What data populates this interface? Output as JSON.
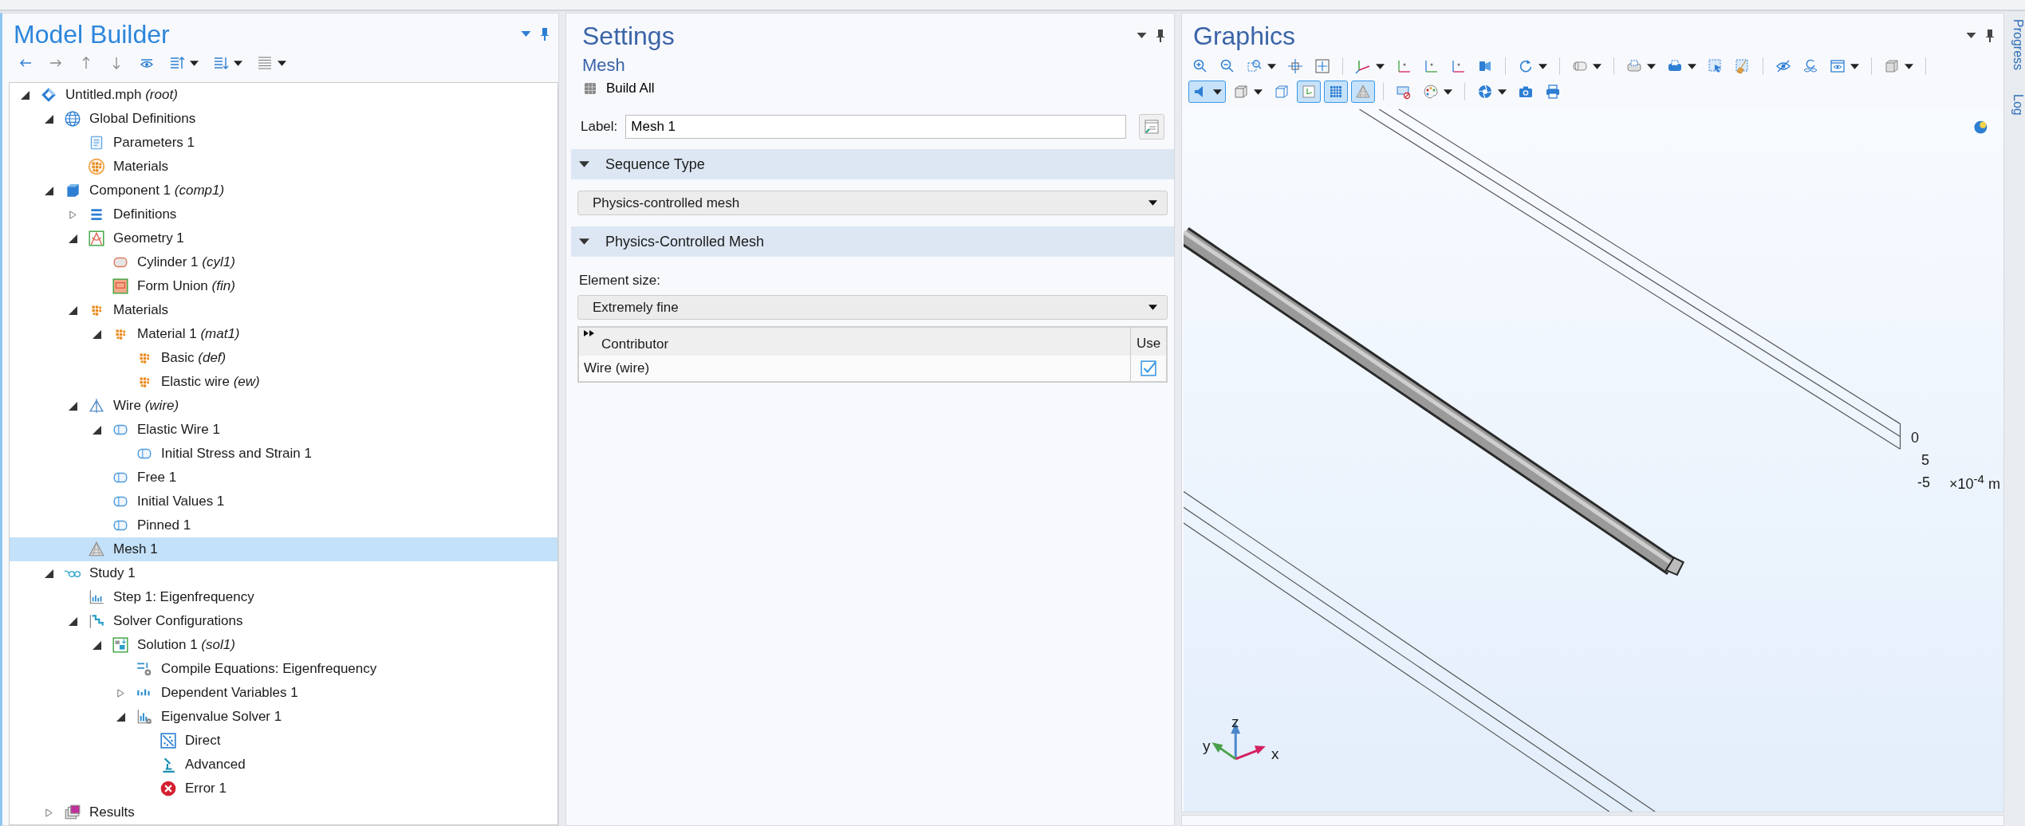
{
  "model_builder": {
    "title": "Model Builder",
    "toolbar": [
      {
        "kind": "back",
        "dropdown": false
      },
      {
        "kind": "forward",
        "dropdown": false
      },
      {
        "kind": "up",
        "dropdown": false
      },
      {
        "kind": "down",
        "dropdown": false
      },
      {
        "kind": "show",
        "dropdown": false
      },
      {
        "kind": "list-up",
        "dropdown": true
      },
      {
        "kind": "list-down",
        "dropdown": true
      },
      {
        "kind": "list",
        "dropdown": true
      }
    ],
    "tree": [
      {
        "label": "Untitled.mph  *(root)*",
        "kind": "root",
        "expanded": true,
        "selected": false,
        "children": [
          {
            "label": "Global Definitions",
            "kind": "globe",
            "expanded": true,
            "selected": false,
            "children": [
              {
                "label": "Parameters 1",
                "kind": "parameters",
                "selected": false
              },
              {
                "label": "Materials",
                "kind": "materials",
                "selected": false
              }
            ]
          },
          {
            "label": "Component 1  *(comp1)*",
            "kind": "component",
            "expanded": true,
            "selected": false,
            "children": [
              {
                "label": "Definitions",
                "kind": "definitions",
                "expanded": false,
                "selected": false
              },
              {
                "label": "Geometry 1",
                "kind": "geometry",
                "expanded": true,
                "selected": false,
                "children": [
                  {
                    "label": "Cylinder 1  *(cyl1)*",
                    "kind": "cylinder",
                    "selected": false
                  },
                  {
                    "label": "Form Union  *(fin)*",
                    "kind": "union",
                    "selected": false
                  }
                ]
              },
              {
                "label": "Materials",
                "kind": "material",
                "expanded": true,
                "selected": false,
                "children": [
                  {
                    "label": "Material 1  *(mat1)*",
                    "kind": "material",
                    "expanded": true,
                    "selected": false,
                    "children": [
                      {
                        "label": "Basic  *(def)*",
                        "kind": "material",
                        "selected": false
                      },
                      {
                        "label": "Elastic wire  *(ew)*",
                        "kind": "material",
                        "selected": false
                      }
                    ]
                  }
                ]
              },
              {
                "label": "Wire  *(wire)*",
                "kind": "physics",
                "expanded": true,
                "selected": false,
                "children": [
                  {
                    "label": "Elastic Wire 1",
                    "kind": "feature",
                    "expanded": true,
                    "selected": false,
                    "children": [
                      {
                        "label": "Initial Stress and Strain 1",
                        "kind": "feature",
                        "selected": false
                      }
                    ]
                  },
                  {
                    "label": "Free 1",
                    "kind": "feature",
                    "selected": false
                  },
                  {
                    "label": "Initial Values 1",
                    "kind": "feature",
                    "selected": false
                  },
                  {
                    "label": "Pinned 1",
                    "kind": "feature",
                    "selected": false
                  }
                ]
              },
              {
                "label": "Mesh 1",
                "kind": "mesh",
                "selected": true
              }
            ]
          },
          {
            "label": "Study 1",
            "kind": "study",
            "expanded": true,
            "selected": false,
            "children": [
              {
                "label": "Step 1: Eigenfrequency",
                "kind": "step",
                "selected": false
              },
              {
                "label": "Solver Configurations",
                "kind": "solver-config",
                "expanded": true,
                "selected": false,
                "children": [
                  {
                    "label": "Solution 1  *(sol1)*",
                    "kind": "solution",
                    "expanded": true,
                    "selected": false,
                    "children": [
                      {
                        "label": "Compile Equations: Eigenfrequency",
                        "kind": "compile",
                        "selected": false
                      },
                      {
                        "label": "Dependent Variables 1",
                        "kind": "variables",
                        "expanded": false,
                        "selected": false
                      },
                      {
                        "label": "Eigenvalue Solver 1",
                        "kind": "eigen-solver",
                        "expanded": true,
                        "selected": false,
                        "children": [
                          {
                            "label": "Direct",
                            "kind": "direct",
                            "selected": false
                          },
                          {
                            "label": "Advanced",
                            "kind": "advanced",
                            "selected": false
                          },
                          {
                            "label": "Error 1",
                            "kind": "error",
                            "selected": false
                          }
                        ]
                      }
                    ]
                  }
                ]
              }
            ]
          },
          {
            "label": "Results",
            "kind": "results",
            "expanded": false,
            "selected": false
          }
        ]
      }
    ]
  },
  "settings": {
    "title": "Settings",
    "subtitle": "Mesh",
    "build_button": "Build All",
    "label_field": {
      "label": "Label:",
      "value": "Mesh 1"
    },
    "sections": [
      {
        "title": "Sequence Type",
        "expanded": true,
        "dropdown": "Physics-controlled mesh"
      },
      {
        "title": "Physics-Controlled Mesh",
        "expanded": true,
        "field_label": "Element size:",
        "dropdown": "Extremely fine",
        "table": {
          "columns": [
            "Contributor",
            "Use"
          ],
          "rows": [
            {
              "contributor": "Wire (wire)",
              "use": true
            }
          ]
        }
      }
    ]
  },
  "graphics": {
    "title": "Graphics",
    "toolbar_rows": [
      [
        {
          "kind": "zoom-in",
          "dropdown": false,
          "on": false
        },
        {
          "kind": "zoom-out",
          "dropdown": false,
          "on": false
        },
        {
          "kind": "zoom-box",
          "dropdown": true,
          "on": false
        },
        {
          "kind": "center",
          "dropdown": false,
          "on": false
        },
        {
          "kind": "fit",
          "dropdown": false,
          "on": false
        },
        {
          "kind": "separator"
        },
        {
          "kind": "axes",
          "dropdown": true,
          "on": false
        },
        {
          "kind": "view-xy",
          "dropdown": false,
          "on": false
        },
        {
          "kind": "view-yz",
          "dropdown": false,
          "on": false
        },
        {
          "kind": "view-xz",
          "dropdown": false,
          "on": false
        },
        {
          "kind": "camera-view",
          "dropdown": false,
          "on": false
        },
        {
          "kind": "separator"
        },
        {
          "kind": "rotate",
          "dropdown": true,
          "on": false
        },
        {
          "kind": "separator"
        },
        {
          "kind": "cylinder-view",
          "dropdown": true,
          "on": false
        },
        {
          "kind": "separator"
        },
        {
          "kind": "select-entity",
          "dropdown": true,
          "on": false
        },
        {
          "kind": "select-domain",
          "dropdown": true,
          "on": false
        },
        {
          "kind": "select-box",
          "dropdown": false,
          "on": false
        },
        {
          "kind": "clear",
          "dropdown": false,
          "on": false
        },
        {
          "kind": "separator"
        },
        {
          "kind": "hide",
          "dropdown": false,
          "on": false
        },
        {
          "kind": "reset-hide",
          "dropdown": false,
          "on": false
        },
        {
          "kind": "view",
          "dropdown": true,
          "on": false
        },
        {
          "kind": "separator"
        },
        {
          "kind": "box-3d",
          "dropdown": true,
          "on": false
        },
        {
          "kind": "separator"
        }
      ],
      [
        {
          "kind": "light",
          "dropdown": true,
          "on": true
        },
        {
          "kind": "box-wire",
          "dropdown": true,
          "on": false
        },
        {
          "kind": "box-plain",
          "dropdown": false,
          "on": false
        },
        {
          "kind": "axis-toggle",
          "dropdown": false,
          "on": true
        },
        {
          "kind": "grid",
          "dropdown": false,
          "on": true
        },
        {
          "kind": "mesh-toggle",
          "dropdown": false,
          "on": true
        },
        {
          "kind": "separator"
        },
        {
          "kind": "hide-select",
          "dropdown": false,
          "on": false
        },
        {
          "kind": "palette",
          "dropdown": true,
          "on": false
        },
        {
          "kind": "separator"
        },
        {
          "kind": "aperture",
          "dropdown": true,
          "on": false
        },
        {
          "kind": "camera",
          "dropdown": false,
          "on": false
        },
        {
          "kind": "printer",
          "dropdown": false,
          "on": false
        }
      ]
    ],
    "scale_labels": [
      "0",
      "5",
      "-5"
    ],
    "scale_unit": "×10$^{-4}$ m",
    "triad": {
      "x": "x",
      "y": "y",
      "z": "z"
    }
  },
  "side_tabs": [
    {
      "label": "Progress"
    },
    {
      "label": "Log"
    }
  ]
}
